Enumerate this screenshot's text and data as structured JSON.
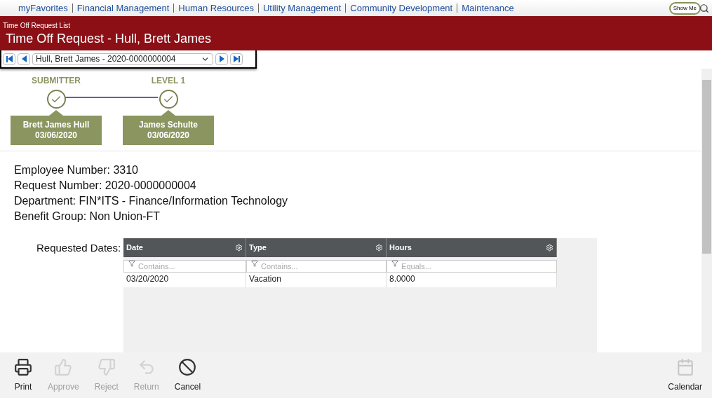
{
  "top_nav": {
    "links": [
      "myFavorites",
      "Financial Management",
      "Human Resources",
      "Utility Management",
      "Community Development",
      "Maintenance"
    ],
    "show_me": "Show Me"
  },
  "header": {
    "breadcrumb": "Time Off Request List",
    "title": "Time Off Request - Hull, Brett James"
  },
  "record_nav": {
    "value": "Hull, Brett James - 2020-0000000004"
  },
  "workflow": [
    {
      "label": "SUBMITTER",
      "name": "Brett James Hull",
      "date": "03/06/2020",
      "done": true
    },
    {
      "label": "LEVEL 1",
      "name": "James Schulte",
      "date": "03/06/2020",
      "done": true
    }
  ],
  "details": [
    "Employee Number: 3310",
    "Request Number: 2020-0000000004",
    "Department: FIN*ITS - Finance/Information Technology",
    "Benefit Group: Non Union-FT"
  ],
  "requested_dates": {
    "label": "Requested Dates:",
    "columns": [
      {
        "title": "Date",
        "placeholder": "Contains..."
      },
      {
        "title": "Type",
        "placeholder": "Contains..."
      },
      {
        "title": "Hours",
        "placeholder": "Equals..."
      }
    ],
    "rows": [
      [
        "03/20/2020",
        "Vacation",
        "8.0000"
      ]
    ]
  },
  "toolbar": [
    {
      "kind": "print",
      "label": "Print",
      "disabled": false
    },
    {
      "kind": "approve",
      "label": "Approve",
      "disabled": true
    },
    {
      "kind": "reject",
      "label": "Reject",
      "disabled": true
    },
    {
      "kind": "return",
      "label": "Return",
      "disabled": true
    },
    {
      "kind": "cancel",
      "label": "Cancel",
      "disabled": false
    }
  ],
  "toolbar_right": {
    "kind": "calendar",
    "label": "Calendar",
    "disabled": false
  }
}
